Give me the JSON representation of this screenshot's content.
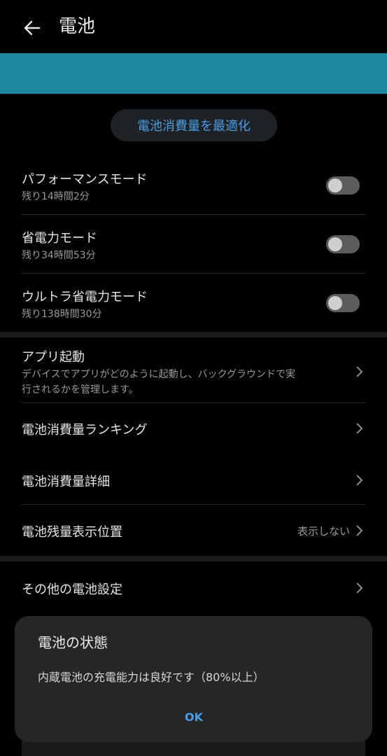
{
  "header": {
    "title": "電池"
  },
  "optimize_button": "電池消費量を最適化",
  "modes": [
    {
      "label": "パフォーマンスモード",
      "sub": "残り14時間2分"
    },
    {
      "label": "省電力モード",
      "sub": "残り34時間53分"
    },
    {
      "label": "ウルトラ省電力モード",
      "sub": "残り138時間30分"
    }
  ],
  "app_launch": {
    "label": "アプリ起動",
    "desc_line1": "デバイスでアプリがどのように起動し、バックグラウンドで実",
    "desc_line2": "行されるかを管理します。"
  },
  "ranking": {
    "label": "電池消費量ランキング"
  },
  "details": {
    "label": "電池消費量詳細"
  },
  "position": {
    "label": "電池残量表示位置",
    "value": "表示しない"
  },
  "other": {
    "label": "その他の電池設定"
  },
  "dialog": {
    "title": "電池の状態",
    "message": "内蔵電池の充電能力は良好です（80%以上）",
    "ok": "OK"
  },
  "colors": {
    "banner": "#1f879e",
    "accent": "#4a9ee6",
    "background": "#000000",
    "dialog": "#262626"
  }
}
